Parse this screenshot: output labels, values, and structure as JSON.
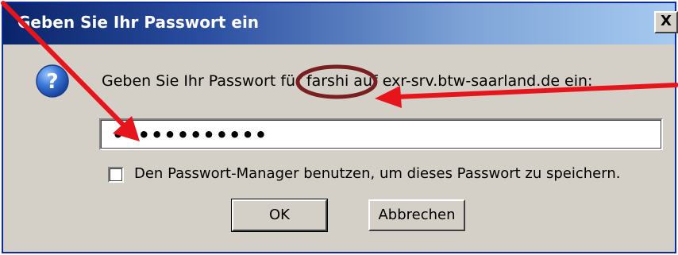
{
  "dialog": {
    "title": "Geben Sie Ihr Passwort ein",
    "close_label": "X",
    "prompt": "Geben Sie Ihr Passwort für farshi auf exr-srv.btw-saarland.de ein:",
    "password_masked": "••••••••••••",
    "remember_checked": false,
    "remember_label": "Den Passwort-Manager benutzen, um dieses Passwort zu speichern.",
    "ok_label": "OK",
    "cancel_label": "Abbrechen",
    "icon": "question-icon"
  },
  "annotations": {
    "arrow_color": "#e8141c",
    "circle_color": "#7a1f1f"
  },
  "colors": {
    "window_bg": "#d4d0c8",
    "titlebar_start": "#0a246a",
    "titlebar_end": "#a6caf0",
    "title_text": "#ffffff"
  }
}
